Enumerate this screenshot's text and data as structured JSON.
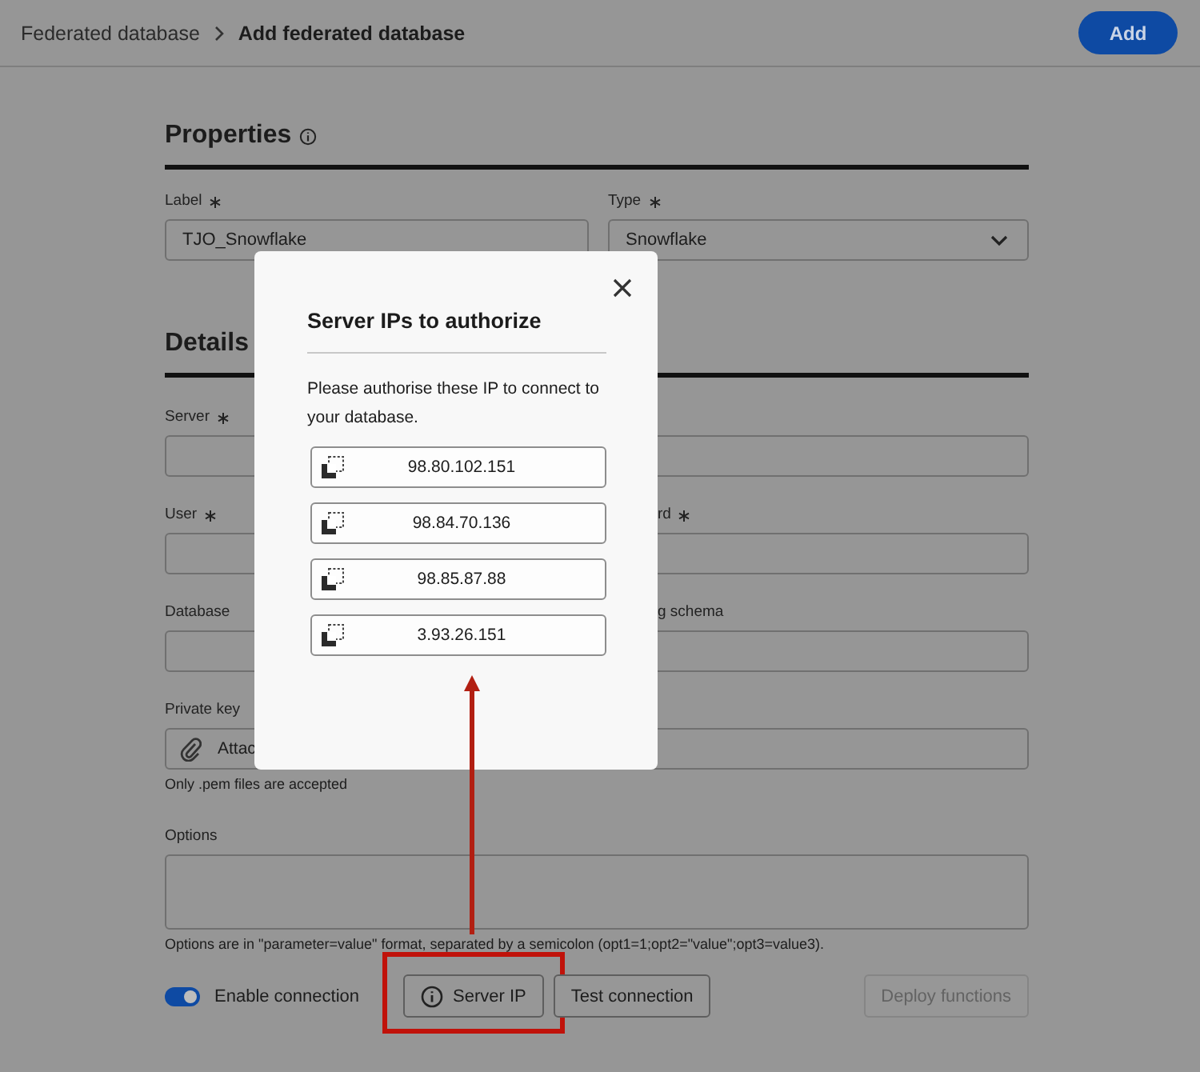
{
  "breadcrumb": {
    "parent": "Federated database",
    "current": "Add federated database"
  },
  "add_button": "Add",
  "properties": {
    "title": "Properties",
    "fields": [
      {
        "label": "Label",
        "required": true,
        "value": "TJO_Snowflake",
        "kind": "text"
      },
      {
        "label": "Type",
        "required": true,
        "value": "Snowflake",
        "kind": "select"
      }
    ]
  },
  "details": {
    "title": "Details",
    "fields": [
      {
        "label": "Server",
        "required": true,
        "kind": "text"
      },
      {
        "kind": "text"
      },
      {
        "label": "User",
        "required": true,
        "kind": "text"
      },
      {
        "label": "rd",
        "required": true,
        "kind": "text"
      },
      {
        "label": "Database",
        "kind": "text"
      },
      {
        "label": "g schema",
        "kind": "text"
      }
    ]
  },
  "private_key": {
    "label": "Private key",
    "button": "Attac",
    "hint": "Only .pem files are accepted"
  },
  "options": {
    "label": "Options",
    "hint": "Options are in \"parameter=value\" format, separated by a semicolon (opt1=1;opt2=\"value\";opt3=value3)."
  },
  "enable_connection": {
    "label": "Enable connection",
    "on": true
  },
  "buttons": [
    {
      "label": "Server IP",
      "kind": "info",
      "disabled": false,
      "highlighted": true
    },
    {
      "label": "Test connection",
      "kind": "plain",
      "disabled": false,
      "highlighted": false
    },
    {
      "label": "Deploy functions",
      "kind": "plain",
      "disabled": true,
      "highlighted": false
    }
  ],
  "dialog": {
    "title": "Server IPs to authorize",
    "message": "Please authorise these IP to connect to your database.",
    "ips": [
      "98.80.102.151",
      "98.84.70.136",
      "98.85.87.88",
      "3.93.26.151"
    ]
  }
}
